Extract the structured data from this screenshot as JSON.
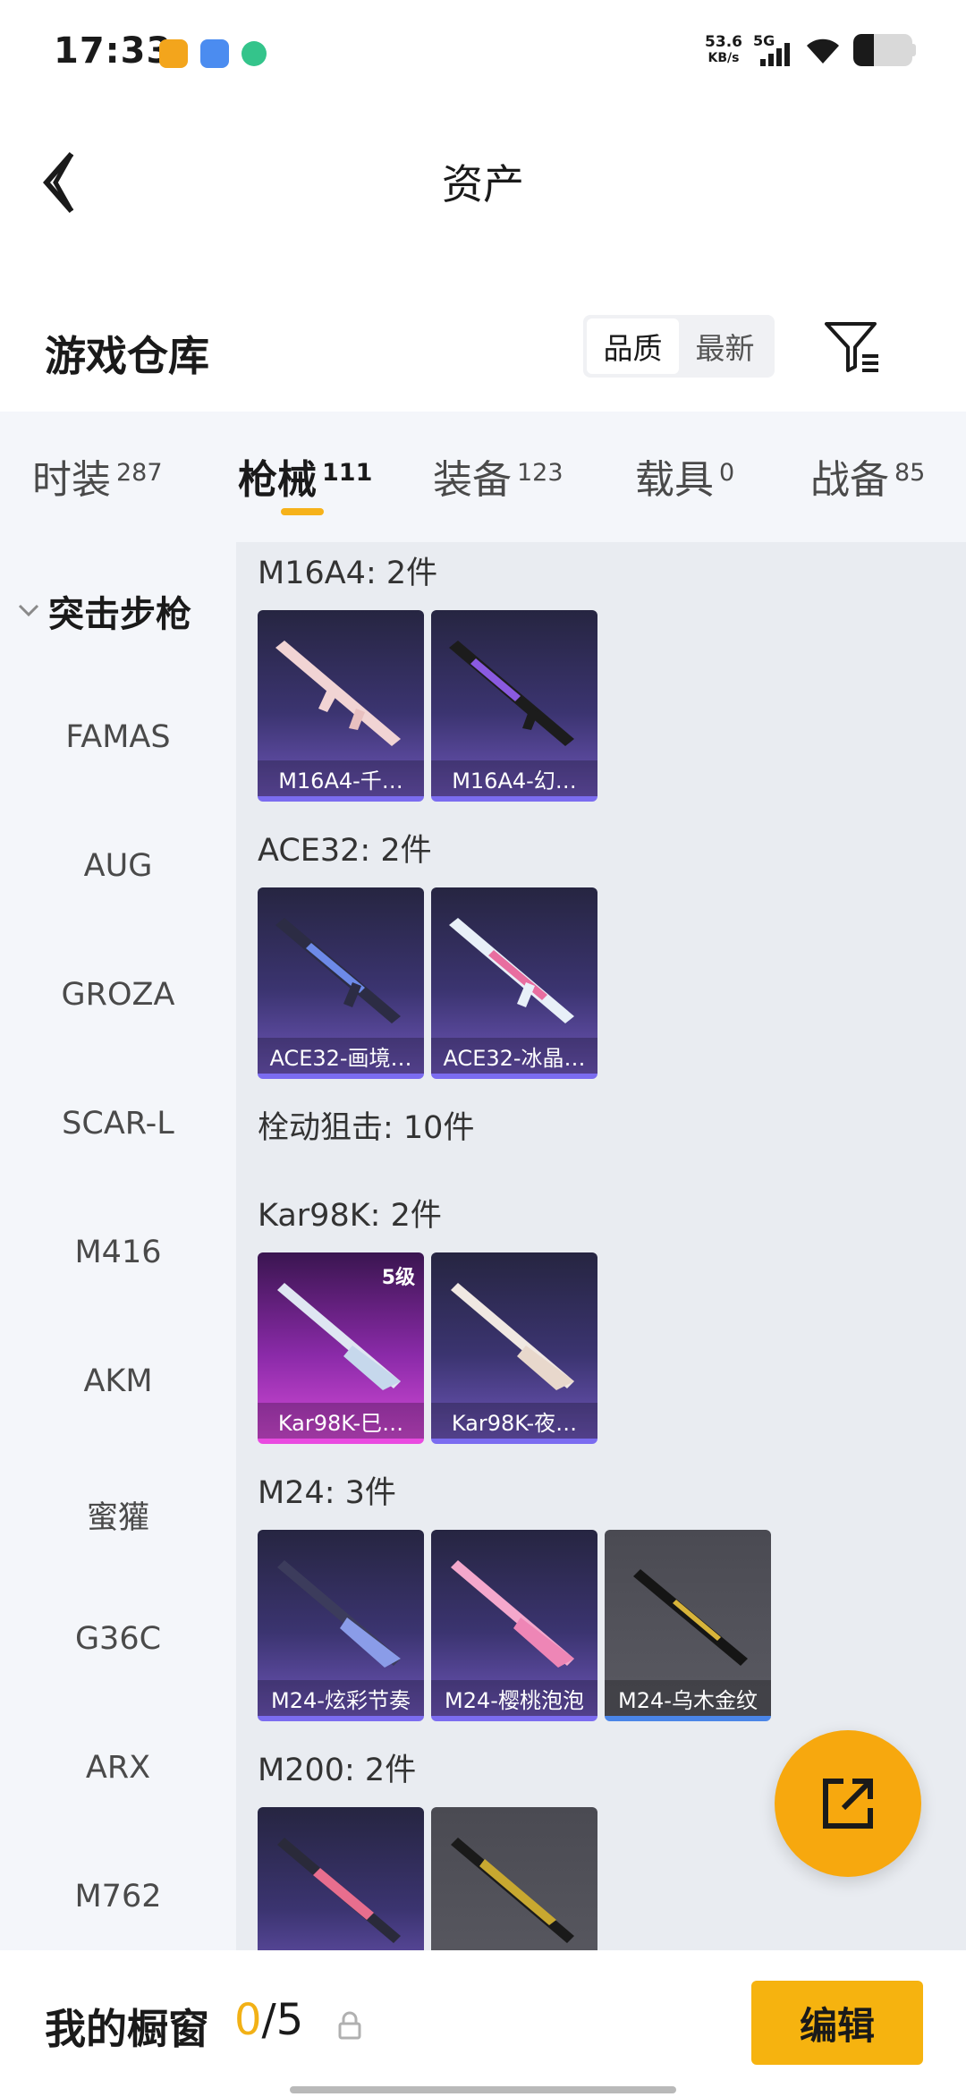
{
  "status_bar": {
    "time": "17:33",
    "net_speed_value": "53.6",
    "net_speed_unit": "KB/s",
    "network_type": "5G",
    "battery_level": 0.35
  },
  "header": {
    "title": "资产"
  },
  "warehouse": {
    "title": "游戏仓库",
    "sort_options": [
      "品质",
      "最新"
    ],
    "selected_sort": "品质"
  },
  "tabs": [
    {
      "label": "时装",
      "count": "287"
    },
    {
      "label": "枪械",
      "count": "111"
    },
    {
      "label": "装备",
      "count": "123"
    },
    {
      "label": "载具",
      "count": "0"
    },
    {
      "label": "战备",
      "count": "85"
    }
  ],
  "active_tab": "枪械",
  "sidebar": {
    "category": "突击步枪",
    "items": [
      "FAMAS",
      "AUG",
      "GROZA",
      "SCAR-L",
      "M416",
      "AKM",
      "蜜獾",
      "G36C",
      "ARX",
      "M762"
    ]
  },
  "groups": [
    {
      "title": "M16A4: 2件",
      "items": [
        "M16A4-千…",
        "M16A4-幻…"
      ]
    },
    {
      "title": "ACE32: 2件",
      "items": [
        "ACE32-画境…",
        "ACE32-冰晶…"
      ]
    },
    {
      "title": "栓动狙击: 10件"
    },
    {
      "title": "Kar98K: 2件",
      "items": [
        "Kar98K-巳…",
        "Kar98K-夜…"
      ],
      "badge": "5级"
    },
    {
      "title": "M24: 3件",
      "items": [
        "M24-炫彩节奏",
        "M24-樱桃泡泡",
        "M24-乌木金纹"
      ]
    },
    {
      "title": "M200: 2件"
    }
  ],
  "showcase": {
    "title": "我的橱窗",
    "current": "0",
    "max": "5",
    "edit_label": "编辑"
  },
  "colors": {
    "accent": "#f6b30f",
    "card_purple": "#3b3470",
    "card_pink": "#d24ad6",
    "card_gray": "#5a5a62"
  }
}
